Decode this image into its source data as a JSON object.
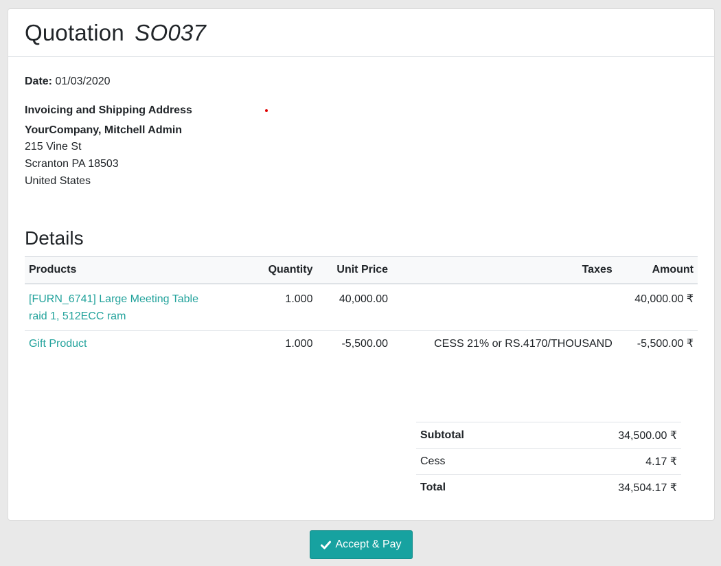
{
  "header": {
    "title": "Quotation",
    "number": "SO037"
  },
  "info": {
    "date_label": "Date:",
    "date_value": "01/03/2020",
    "address_heading": "Invoicing and Shipping Address",
    "address_name": "YourCompany, Mitchell Admin",
    "address_lines": [
      "215 Vine St",
      "Scranton PA 18503",
      "United States"
    ]
  },
  "details": {
    "title": "Details",
    "columns": [
      "Products",
      "Quantity",
      "Unit Price",
      "Taxes",
      "Amount"
    ],
    "rows": [
      {
        "product_line1": "[FURN_6741] Large Meeting Table",
        "product_line2": "raid 1, 512ECC ram",
        "quantity": "1.000",
        "unit_price": "40,000.00",
        "taxes": "",
        "amount": "40,000.00 ₹"
      },
      {
        "product_line1": "Gift Product",
        "product_line2": "",
        "quantity": "1.000",
        "unit_price": "-5,500.00",
        "taxes": "CESS 21% or RS.4170/THOUSAND",
        "amount": "-5,500.00 ₹"
      }
    ]
  },
  "totals": [
    {
      "label": "Subtotal",
      "value": "34,500.00 ₹"
    },
    {
      "label": "Cess",
      "value": "4.17 ₹"
    },
    {
      "label": "Total",
      "value": "34,504.17 ₹"
    }
  ],
  "actions": {
    "accept_label": "Accept & Pay",
    "accept_icon": "check-icon"
  },
  "colors": {
    "accent": "#17a2a0",
    "link": "#21a29b"
  }
}
